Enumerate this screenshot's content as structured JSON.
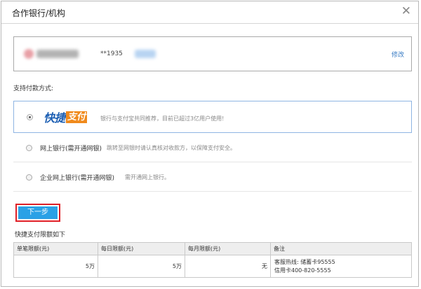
{
  "dialog": {
    "title": "合作银行/机构",
    "close_icon": "close-icon"
  },
  "card": {
    "number": "**1935",
    "modify_label": "修改"
  },
  "payment": {
    "section_label": "支持付款方式:",
    "options": [
      {
        "logo_part1": "快捷",
        "logo_part2": "支付",
        "description": "银行与支付宝共同推荐，目前已超过3亿用户使用!",
        "selected": true
      },
      {
        "label": "网上银行(需开通网银)",
        "description": "跳转至网银时请认真核对收款方，以保障支付安全。",
        "selected": false
      },
      {
        "label": "企业网上银行(需开通网银)",
        "description": "需开通网上银行。",
        "selected": false
      }
    ]
  },
  "next_button": "下一步",
  "limits": {
    "title": "快捷支付限额如下",
    "headers": [
      "单笔限额(元)",
      "每日限额(元)",
      "每月限额(元)",
      "备注"
    ],
    "row": {
      "single": "5万",
      "daily": "5万",
      "monthly": "无",
      "note_line1": "客服热线: 储蓄卡95555",
      "note_line2": "信用卡400-820-5555"
    }
  },
  "colors": {
    "accent_blue": "#2aa1e6",
    "highlight_red": "#e01f26",
    "link_blue": "#3a7cc4",
    "selected_border": "#8fb5e3",
    "logo_orange": "#f08a1c"
  }
}
